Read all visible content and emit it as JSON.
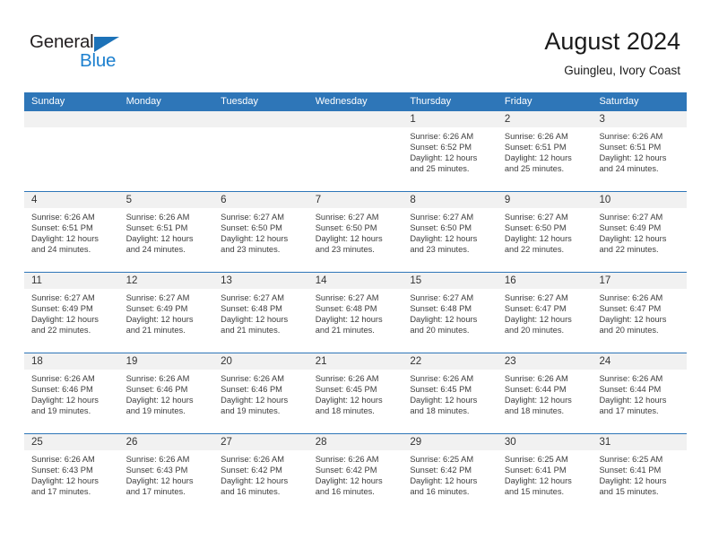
{
  "brand": {
    "name_part1": "General",
    "name_part2": "Blue",
    "triangle_icon": "triangle-icon",
    "color_dark": "#231f20",
    "color_blue": "#1d80cf"
  },
  "header": {
    "title": "August 2024",
    "location": "Guingleu, Ivory Coast"
  },
  "colors": {
    "header_blue": "#2e76b8",
    "day_strip_gray": "#f1f1f1",
    "text": "#3d3d3d"
  },
  "weekdays": [
    "Sunday",
    "Monday",
    "Tuesday",
    "Wednesday",
    "Thursday",
    "Friday",
    "Saturday"
  ],
  "weeks": [
    [
      {
        "day": "",
        "empty": true
      },
      {
        "day": "",
        "empty": true
      },
      {
        "day": "",
        "empty": true
      },
      {
        "day": "",
        "empty": true
      },
      {
        "day": "1",
        "sunrise": "Sunrise: 6:26 AM",
        "sunset": "Sunset: 6:52 PM",
        "daylight": "Daylight: 12 hours and 25 minutes."
      },
      {
        "day": "2",
        "sunrise": "Sunrise: 6:26 AM",
        "sunset": "Sunset: 6:51 PM",
        "daylight": "Daylight: 12 hours and 25 minutes."
      },
      {
        "day": "3",
        "sunrise": "Sunrise: 6:26 AM",
        "sunset": "Sunset: 6:51 PM",
        "daylight": "Daylight: 12 hours and 24 minutes."
      }
    ],
    [
      {
        "day": "4",
        "sunrise": "Sunrise: 6:26 AM",
        "sunset": "Sunset: 6:51 PM",
        "daylight": "Daylight: 12 hours and 24 minutes."
      },
      {
        "day": "5",
        "sunrise": "Sunrise: 6:26 AM",
        "sunset": "Sunset: 6:51 PM",
        "daylight": "Daylight: 12 hours and 24 minutes."
      },
      {
        "day": "6",
        "sunrise": "Sunrise: 6:27 AM",
        "sunset": "Sunset: 6:50 PM",
        "daylight": "Daylight: 12 hours and 23 minutes."
      },
      {
        "day": "7",
        "sunrise": "Sunrise: 6:27 AM",
        "sunset": "Sunset: 6:50 PM",
        "daylight": "Daylight: 12 hours and 23 minutes."
      },
      {
        "day": "8",
        "sunrise": "Sunrise: 6:27 AM",
        "sunset": "Sunset: 6:50 PM",
        "daylight": "Daylight: 12 hours and 23 minutes."
      },
      {
        "day": "9",
        "sunrise": "Sunrise: 6:27 AM",
        "sunset": "Sunset: 6:50 PM",
        "daylight": "Daylight: 12 hours and 22 minutes."
      },
      {
        "day": "10",
        "sunrise": "Sunrise: 6:27 AM",
        "sunset": "Sunset: 6:49 PM",
        "daylight": "Daylight: 12 hours and 22 minutes."
      }
    ],
    [
      {
        "day": "11",
        "sunrise": "Sunrise: 6:27 AM",
        "sunset": "Sunset: 6:49 PM",
        "daylight": "Daylight: 12 hours and 22 minutes."
      },
      {
        "day": "12",
        "sunrise": "Sunrise: 6:27 AM",
        "sunset": "Sunset: 6:49 PM",
        "daylight": "Daylight: 12 hours and 21 minutes."
      },
      {
        "day": "13",
        "sunrise": "Sunrise: 6:27 AM",
        "sunset": "Sunset: 6:48 PM",
        "daylight": "Daylight: 12 hours and 21 minutes."
      },
      {
        "day": "14",
        "sunrise": "Sunrise: 6:27 AM",
        "sunset": "Sunset: 6:48 PM",
        "daylight": "Daylight: 12 hours and 21 minutes."
      },
      {
        "day": "15",
        "sunrise": "Sunrise: 6:27 AM",
        "sunset": "Sunset: 6:48 PM",
        "daylight": "Daylight: 12 hours and 20 minutes."
      },
      {
        "day": "16",
        "sunrise": "Sunrise: 6:27 AM",
        "sunset": "Sunset: 6:47 PM",
        "daylight": "Daylight: 12 hours and 20 minutes."
      },
      {
        "day": "17",
        "sunrise": "Sunrise: 6:26 AM",
        "sunset": "Sunset: 6:47 PM",
        "daylight": "Daylight: 12 hours and 20 minutes."
      }
    ],
    [
      {
        "day": "18",
        "sunrise": "Sunrise: 6:26 AM",
        "sunset": "Sunset: 6:46 PM",
        "daylight": "Daylight: 12 hours and 19 minutes."
      },
      {
        "day": "19",
        "sunrise": "Sunrise: 6:26 AM",
        "sunset": "Sunset: 6:46 PM",
        "daylight": "Daylight: 12 hours and 19 minutes."
      },
      {
        "day": "20",
        "sunrise": "Sunrise: 6:26 AM",
        "sunset": "Sunset: 6:46 PM",
        "daylight": "Daylight: 12 hours and 19 minutes."
      },
      {
        "day": "21",
        "sunrise": "Sunrise: 6:26 AM",
        "sunset": "Sunset: 6:45 PM",
        "daylight": "Daylight: 12 hours and 18 minutes."
      },
      {
        "day": "22",
        "sunrise": "Sunrise: 6:26 AM",
        "sunset": "Sunset: 6:45 PM",
        "daylight": "Daylight: 12 hours and 18 minutes."
      },
      {
        "day": "23",
        "sunrise": "Sunrise: 6:26 AM",
        "sunset": "Sunset: 6:44 PM",
        "daylight": "Daylight: 12 hours and 18 minutes."
      },
      {
        "day": "24",
        "sunrise": "Sunrise: 6:26 AM",
        "sunset": "Sunset: 6:44 PM",
        "daylight": "Daylight: 12 hours and 17 minutes."
      }
    ],
    [
      {
        "day": "25",
        "sunrise": "Sunrise: 6:26 AM",
        "sunset": "Sunset: 6:43 PM",
        "daylight": "Daylight: 12 hours and 17 minutes."
      },
      {
        "day": "26",
        "sunrise": "Sunrise: 6:26 AM",
        "sunset": "Sunset: 6:43 PM",
        "daylight": "Daylight: 12 hours and 17 minutes."
      },
      {
        "day": "27",
        "sunrise": "Sunrise: 6:26 AM",
        "sunset": "Sunset: 6:42 PM",
        "daylight": "Daylight: 12 hours and 16 minutes."
      },
      {
        "day": "28",
        "sunrise": "Sunrise: 6:26 AM",
        "sunset": "Sunset: 6:42 PM",
        "daylight": "Daylight: 12 hours and 16 minutes."
      },
      {
        "day": "29",
        "sunrise": "Sunrise: 6:25 AM",
        "sunset": "Sunset: 6:42 PM",
        "daylight": "Daylight: 12 hours and 16 minutes."
      },
      {
        "day": "30",
        "sunrise": "Sunrise: 6:25 AM",
        "sunset": "Sunset: 6:41 PM",
        "daylight": "Daylight: 12 hours and 15 minutes."
      },
      {
        "day": "31",
        "sunrise": "Sunrise: 6:25 AM",
        "sunset": "Sunset: 6:41 PM",
        "daylight": "Daylight: 12 hours and 15 minutes."
      }
    ]
  ]
}
